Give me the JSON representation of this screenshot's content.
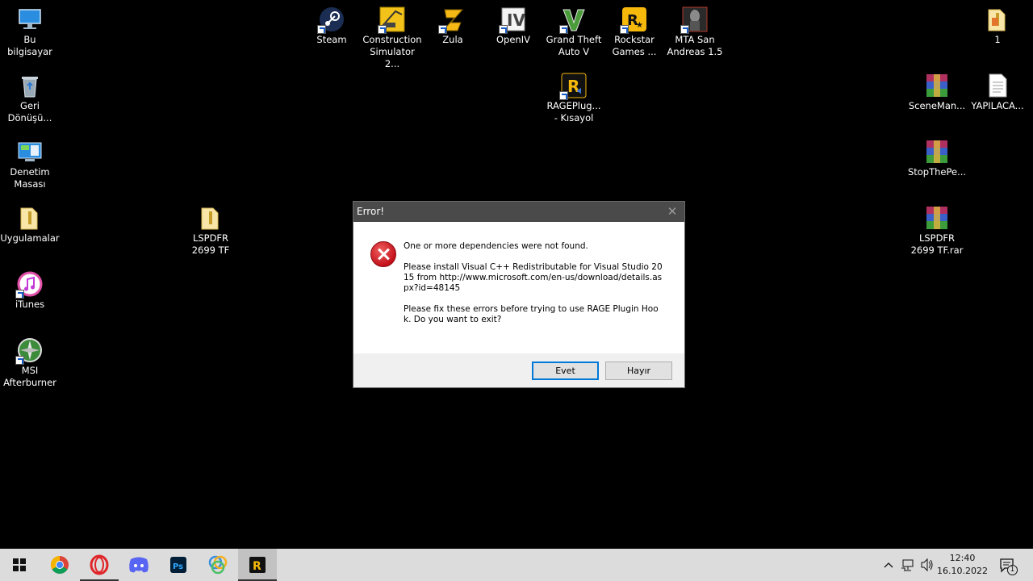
{
  "desktop": {
    "icons": {
      "this_pc": "Bu bilgisayar",
      "recycle_bin": "Geri\nDönüşü...",
      "control_panel": "Denetim\nMasası",
      "apps": "Uygulamalar",
      "itunes": "iTunes",
      "msi": "MSI\nAfterburner",
      "lspdfr_folder": "LSPDFR\n2699 TF",
      "steam": "Steam",
      "construction": "Construction\nSimulator 2...",
      "zula": "Zula",
      "openiv": "OpenIV",
      "gta5": "Grand Theft\nAuto V",
      "rockstar": "Rockstar\nGames ...",
      "mta": "MTA San\nAndreas 1.5",
      "rageplugin": "RAGEPlug...\n- Kısayol",
      "folder_1": "1",
      "sceneman": "SceneMan...",
      "yapilaca": "YAPILACA...",
      "stopthepe": "StopThePe...",
      "lspdfr_rar": "LSPDFR\n2699 TF.rar"
    }
  },
  "dialog": {
    "title": "Error!",
    "close_glyph": "✕",
    "line1": "One or more dependencies were not found.",
    "line2": "Please install Visual C++ Redistributable for Visual Studio 2015 from http://www.microsoft.com/en-us/download/details.aspx?id=48145",
    "line3": "Please fix these errors before trying to use RAGE Plugin Hook. Do you want to exit?",
    "yes_label": "Evet",
    "no_label": "Hayır"
  },
  "taskbar": {
    "time": "12:40",
    "date": "16.10.2022",
    "notification_count": "1"
  }
}
